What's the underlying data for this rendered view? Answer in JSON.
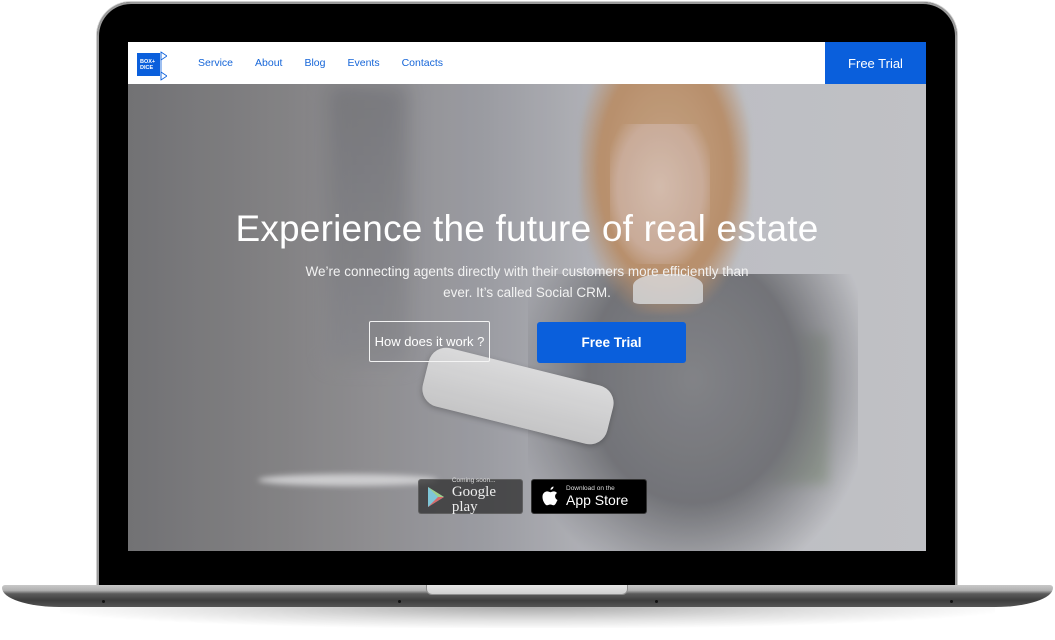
{
  "brand": {
    "logo_text_line1": "BOX+",
    "logo_text_line2": "DICE",
    "accent_color": "#0a5fdc"
  },
  "nav": {
    "links": [
      {
        "label": "Service"
      },
      {
        "label": "About"
      },
      {
        "label": "Blog"
      },
      {
        "label": "Events"
      },
      {
        "label": "Contacts"
      }
    ],
    "cta_label": "Free Trial"
  },
  "hero": {
    "headline": "Experience the future of real estate",
    "subline": "We’re connecting agents directly with their customers more efficiently than ever. It’s called Social CRM.",
    "secondary_button": "How does it work  ?",
    "primary_button": "Free Trial"
  },
  "stores": {
    "google": {
      "small": "Coming soon...",
      "big": "Google play",
      "icon": "google-play-icon"
    },
    "apple": {
      "small": "Download on the",
      "big": "App Store",
      "icon": "apple-icon"
    }
  }
}
